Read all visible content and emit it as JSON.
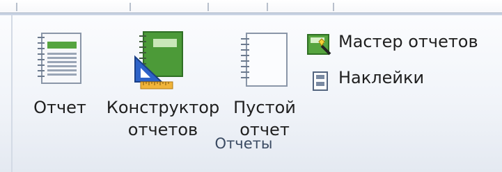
{
  "ribbon": {
    "group_title": "Отчеты",
    "buttons": {
      "report": {
        "icon": "report-icon",
        "label": "Отчет"
      },
      "report_designer": {
        "icon": "report-designer-icon",
        "line1": "Конструктор",
        "line2": "отчетов"
      },
      "blank_report": {
        "icon": "blank-report-icon",
        "line1": "Пустой",
        "line2": "отчет"
      },
      "report_wizard": {
        "icon": "report-wizard-icon",
        "label": "Мастер отчетов"
      },
      "labels": {
        "icon": "labels-icon",
        "label": "Наклейки"
      }
    }
  },
  "colors": {
    "accent_green": "#4f9b3c",
    "ribbon_bg": "#eef2f7",
    "group_title": "#3a4a62"
  }
}
